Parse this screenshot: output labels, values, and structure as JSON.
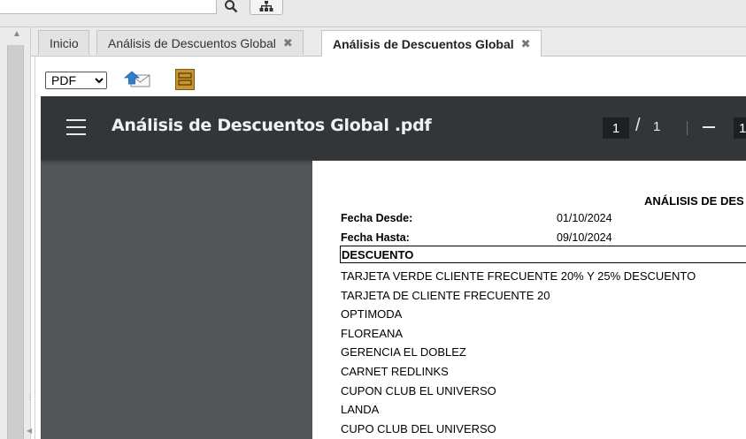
{
  "tabs": [
    {
      "label": "Inicio"
    },
    {
      "label": "Análisis de Descuentos Global",
      "close": "✖"
    },
    {
      "label": "Análisis de Descuentos Global",
      "close": "✖"
    }
  ],
  "toolbar": {
    "format_value": "PDF",
    "format_options": [
      "PDF"
    ]
  },
  "viewer": {
    "filename": "Análisis de Descuentos Global .pdf",
    "current_page": "1",
    "separator": "/",
    "total_pages": "1",
    "zoom": "1"
  },
  "report": {
    "title": "ANÁLISIS DE DES",
    "fecha_desde_label": "Fecha Desde:",
    "fecha_desde_value": "01/10/2024",
    "fecha_hasta_label": "Fecha Hasta:",
    "fecha_hasta_value": "09/10/2024",
    "column_header": "DESCUENTO",
    "rows": [
      "TARJETA VERDE CLIENTE FRECUENTE  20% Y 25% DESCUENTO",
      "TARJETA DE CLIENTE FRECUENTE 20",
      "OPTIMODA",
      "FLOREANA",
      "GERENCIA EL DOBLEZ",
      "CARNET REDLINKS",
      "CUPON CLUB  EL UNIVERSO",
      "LANDA",
      "CUPO  CLUB DEL UNIVERSO"
    ]
  },
  "icons": {
    "search": "search-icon",
    "sitemap": "sitemap-icon",
    "email": "email-send-icon",
    "export": "export-folder-icon",
    "menu": "hamburger-icon",
    "zoom_out": "minus-icon"
  },
  "colors": {
    "viewer_bg": "#525659",
    "viewer_header": "#323639",
    "export_icon": "#c8962c"
  }
}
